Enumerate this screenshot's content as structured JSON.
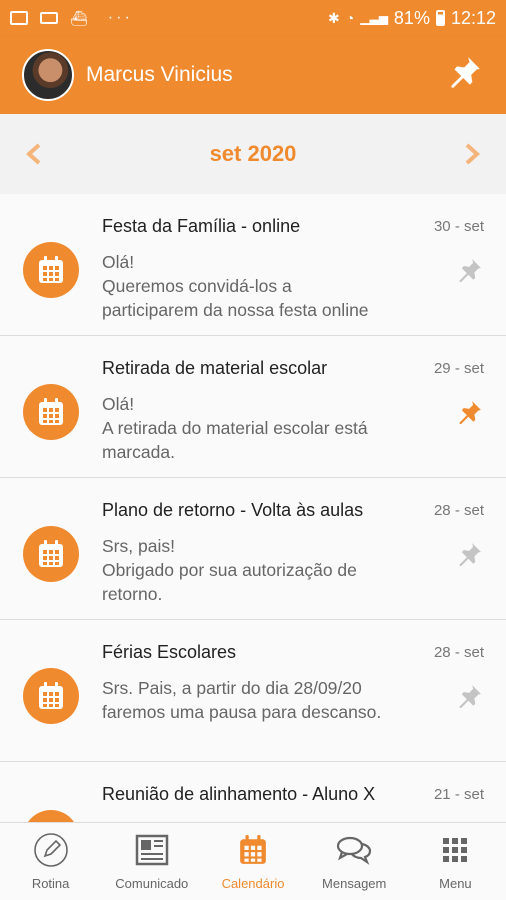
{
  "status_bar": {
    "battery": "81%",
    "time": "12:12",
    "dots": "···"
  },
  "header": {
    "user_name": "Marcus Vinicius"
  },
  "calendar": {
    "month_label": "set 2020"
  },
  "events": [
    {
      "title": "Festa da Família - online",
      "date": "30 - set",
      "line1": "Olá!",
      "line2": "Queremos convidá-los a",
      "line3": "participarem da nossa festa online",
      "pinned": false
    },
    {
      "title": "Retirada de material escolar",
      "date": "29 - set",
      "line1": "Olá!",
      "line2": "A retirada do material escolar está",
      "line3": "marcada.",
      "pinned": true
    },
    {
      "title": "Plano de retorno - Volta às aulas",
      "date": "28 - set",
      "line1": "Srs, pais!",
      "line2": "Obrigado por sua autorização de",
      "line3": "retorno.",
      "pinned": false
    },
    {
      "title": "Férias Escolares",
      "date": "28 - set",
      "line1": "Srs. Pais, a partir do dia 28/09/20",
      "line2": "faremos uma pausa para descanso.",
      "line3": "",
      "pinned": false
    },
    {
      "title": "Reunião de alinhamento - Aluno X",
      "date": "21 - set",
      "line1": "",
      "line2": "",
      "line3": "",
      "pinned": false
    }
  ],
  "bottom_nav": [
    {
      "label": "Rotina",
      "icon": "edit-circle-icon"
    },
    {
      "label": "Comunicado",
      "icon": "newspaper-icon"
    },
    {
      "label": "Calendário",
      "icon": "calendar-icon",
      "active": true
    },
    {
      "label": "Mensagem",
      "icon": "chat-bubbles-icon"
    },
    {
      "label": "Menu",
      "icon": "grid-menu-icon"
    }
  ],
  "colors": {
    "accent": "#f08a2f",
    "pin_inactive": "#c4c4c4",
    "text": "#222222",
    "muted": "#666666"
  }
}
